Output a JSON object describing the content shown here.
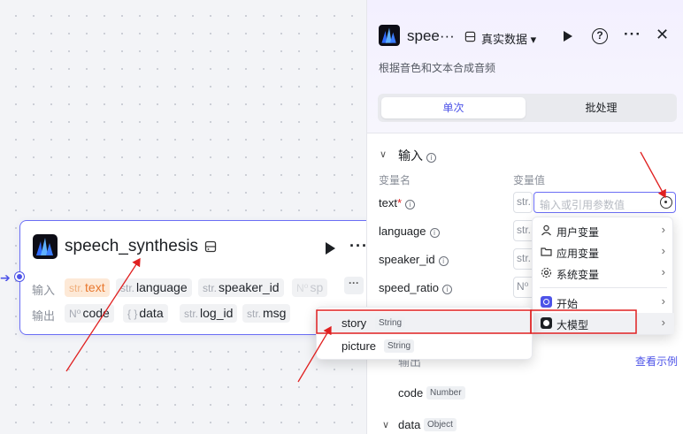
{
  "node": {
    "title": "speech_synthesis",
    "input_label": "输入",
    "output_label": "输出",
    "inputs": [
      {
        "type": "str.",
        "name": "text"
      },
      {
        "type": "str.",
        "name": "language"
      },
      {
        "type": "str.",
        "name": "speaker_id"
      },
      {
        "type": "N⁰",
        "name": "sp"
      }
    ],
    "outputs": [
      {
        "type": "N⁰",
        "name": "code"
      },
      {
        "type": "{ }",
        "name": "data"
      },
      {
        "type": "str.",
        "name": "log_id"
      },
      {
        "type": "str.",
        "name": "msg"
      }
    ],
    "more": "···"
  },
  "panel": {
    "title": "spee···",
    "data_select": "真实数据 ▾",
    "help": "?",
    "more": "···",
    "close": "✕",
    "description": "根据音色和文本合成音频",
    "tabs": {
      "single": "单次",
      "batch": "批处理"
    },
    "section_input": "输入",
    "col_name": "变量名",
    "col_value": "变量值",
    "fields": [
      {
        "label": "text",
        "required": "*",
        "type": "str.",
        "placeholder": "输入或引用参数值"
      },
      {
        "label": "language",
        "type": "str."
      },
      {
        "label": "speaker_id",
        "type": "str."
      },
      {
        "label": "speed_ratio",
        "type": "N⁰"
      }
    ],
    "output_label": "输出",
    "example_link": "查看示例",
    "outputs": [
      {
        "name": "code",
        "type": "Number"
      },
      {
        "name": "data",
        "type": "Object"
      }
    ]
  },
  "menu": {
    "items": [
      {
        "label": "用户变量",
        "icon": "user-icon"
      },
      {
        "label": "应用变量",
        "icon": "folder-icon"
      },
      {
        "label": "系统变量",
        "icon": "gear-icon"
      },
      {
        "label": "开始",
        "icon": "start-icon"
      },
      {
        "label": "大模型",
        "icon": "llm-icon"
      }
    ]
  },
  "submenu": {
    "items": [
      {
        "name": "story",
        "type": "String"
      },
      {
        "name": "picture",
        "type": "String"
      }
    ]
  },
  "colors": {
    "accent": "#4d53e8",
    "annotation": "#e02020",
    "highlight_tag": "#fde9d7"
  }
}
